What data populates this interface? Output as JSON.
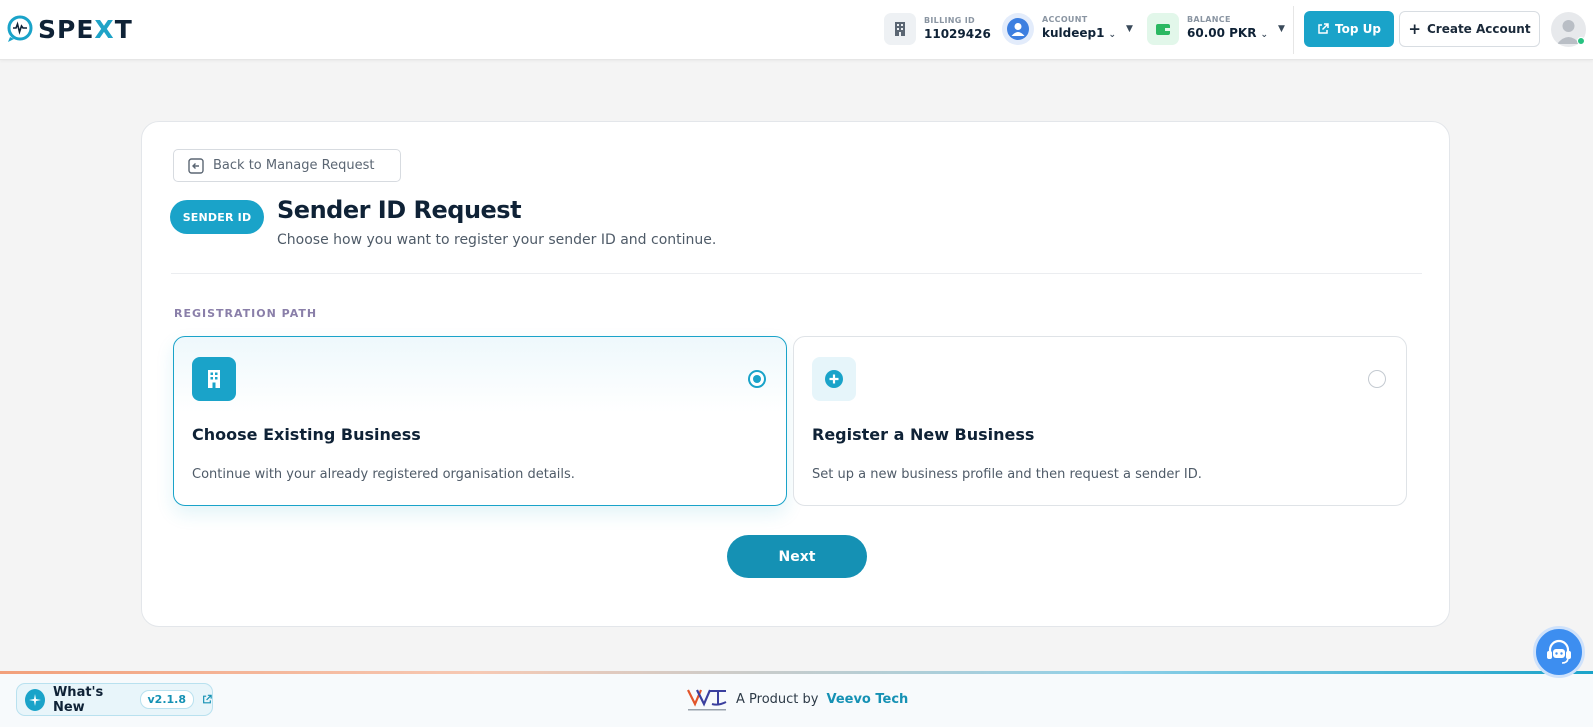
{
  "header": {
    "logo_text_a": "SPE",
    "logo_text_x": "X",
    "logo_text_b": "T",
    "billing": {
      "label": "BILLING ID",
      "value": "11029426",
      "icon": "building-icon"
    },
    "account": {
      "label": "ACCOUNT",
      "value": "kuldeep1",
      "icon": "user-icon"
    },
    "balance": {
      "label": "BALANCE",
      "value": "60.00 PKR",
      "icon": "wallet-icon"
    },
    "topup_label": "Top Up",
    "create_account_label": "Create Account"
  },
  "card": {
    "back_label": "Back to Manage Request",
    "badge": "SENDER ID",
    "title": "Sender ID Request",
    "subtitle": "Choose how you want to register your sender ID and continue.",
    "section_label": "REGISTRATION PATH",
    "options": [
      {
        "title": "Choose Existing Business",
        "description": "Continue with your already registered organisation details.",
        "selected": true,
        "icon": "building-icon"
      },
      {
        "title": "Register a New Business",
        "description": "Set up a new business profile and then request a sender ID.",
        "selected": false,
        "icon": "plus-circle-icon"
      }
    ],
    "next_label": "Next"
  },
  "footer": {
    "whats_new_label": "What's New",
    "version": "v2.1.8",
    "product_prefix": "A Product by",
    "product_brand": "Veevo Tech"
  },
  "colors": {
    "accent": "#1aa3c9",
    "accent_dark": "#1591b4",
    "title": "#0f2236",
    "section_label": "#8a7fa9"
  }
}
